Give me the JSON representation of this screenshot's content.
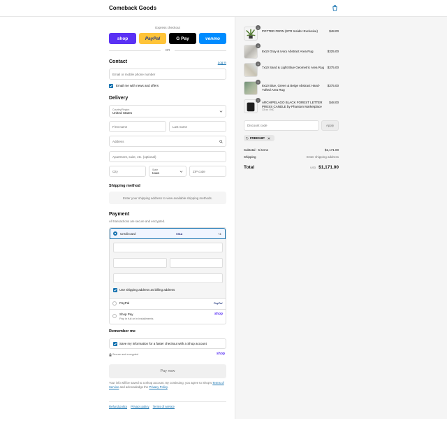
{
  "header": {
    "brand": "Comeback Goods"
  },
  "express": {
    "label": "Express checkout",
    "buttons": [
      {
        "label": "shop",
        "color": "#5a31f4"
      },
      {
        "label": "PayPal",
        "color": "#ffc439"
      },
      {
        "label": "G Pay",
        "color": "#000000"
      },
      {
        "label": "venmo",
        "color": "#008cff"
      }
    ],
    "or": "OR"
  },
  "contact": {
    "title": "Contact",
    "login": "Log in",
    "email_placeholder": "Email or mobile phone number",
    "news_label": "Email me with news and offers"
  },
  "delivery": {
    "title": "Delivery",
    "country_label": "Country/Region",
    "country_value": "United States",
    "first_name": "First name",
    "last_name": "Last name",
    "address": "Address",
    "apartment": "Apartment, suite, etc. (optional)",
    "city": "City",
    "state_label": "State",
    "state_value": "Iowa",
    "zip": "ZIP code"
  },
  "shipping": {
    "title": "Shipping method",
    "note": "Enter your shipping address to view available shipping methods."
  },
  "payment": {
    "title": "Payment",
    "subtitle": "All transactions are secure and encrypted.",
    "credit_card": "Credit card",
    "card_brand": "VISA",
    "more_cards": "+4",
    "billing_label": "Use shipping address as billing address",
    "paypal": "PayPal",
    "paypal_logo": "PayPal",
    "shoppay": "Shop Pay",
    "shoppay_sub": "Pay in full or in installments",
    "shoppay_logo": "shop"
  },
  "remember": {
    "title": "Remember me",
    "save_label": "Save my information for a faster checkout with a Shop account",
    "secure": "Secure and encrypted",
    "shop_logo": "shop"
  },
  "pay_now": "Pay now",
  "legal": {
    "text1": "Your info will be saved to a Shop account. By continuing, you agree to Shop's",
    "terms": "Terms of Service",
    "text2": "and acknowledge the",
    "privacy": "Privacy Policy",
    "end": "."
  },
  "footer_links": [
    "Refund policy",
    "Privacy policy",
    "Terms of service"
  ],
  "cart": {
    "items": [
      {
        "name": "POTTED FERN (STR Insider Exclusive)",
        "qty": "1",
        "price": "$48.00",
        "sub": "",
        "thumb_color": "#6d8a4a"
      },
      {
        "name": "8x10 Gray & Ivory Abstract Area Rug",
        "qty": "1",
        "price": "$325.00",
        "sub": "",
        "thumb_color": "#c9c7c1"
      },
      {
        "name": "7x10 Sand & Light Blue Geometric Area Rug",
        "qty": "1",
        "price": "$375.00",
        "sub": "",
        "thumb_color": "#d7d2c4"
      },
      {
        "name": "8x10 Blue, Green & Beige Abstract Hand-Tufted Area Rug",
        "qty": "1",
        "price": "$375.00",
        "sub": "",
        "thumb_color": "#8fa58c"
      },
      {
        "name": "ARCHIPELAGO BLACK FOREST LETTER PRESS CANDLE by Phantom Marketplace",
        "qty": "1",
        "price": "$48.00",
        "sub": "13 oz / NC",
        "thumb_color": "#1f1f1f"
      }
    ],
    "discount_placeholder": "Discount code",
    "apply": "Apply",
    "code": "FREESHIP",
    "subtotal_label": "Subtotal · 5 items",
    "subtotal_value": "$1,171.00",
    "shipping_label": "Shipping",
    "shipping_value": "Enter shipping address",
    "total_label": "Total",
    "currency": "USD",
    "total_value": "$1,171.00"
  }
}
